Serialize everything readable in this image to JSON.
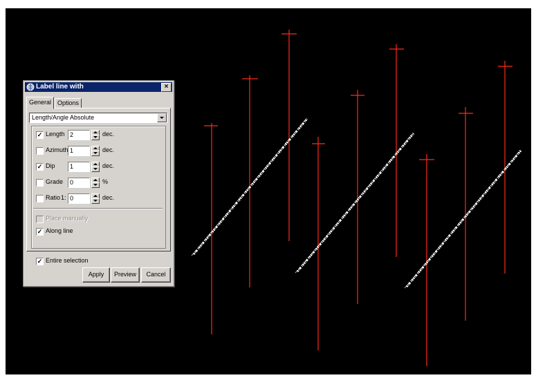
{
  "dialog": {
    "title": "Label line with",
    "close_symbol": "×",
    "tabs": [
      {
        "label": "General",
        "active": true
      },
      {
        "label": "Options",
        "active": false
      }
    ],
    "mode_select": {
      "value": "Length/Angle Absolute"
    },
    "fields": [
      {
        "id": "length",
        "label": "Length",
        "checked": true,
        "value": "2",
        "unit": "dec."
      },
      {
        "id": "azimuth",
        "label": "Azimuth",
        "checked": false,
        "value": "1",
        "unit": "dec."
      },
      {
        "id": "dip",
        "label": "Dip",
        "checked": true,
        "value": "1",
        "unit": "dec."
      },
      {
        "id": "grade",
        "label": "Grade",
        "checked": false,
        "value": "0",
        "unit": "%"
      },
      {
        "id": "ratio",
        "label": "Ratio",
        "checked": false,
        "prefix": "1:",
        "value": "0",
        "unit": "dec."
      }
    ],
    "place_manually": {
      "label": "Place manually",
      "checked": false,
      "disabled": true
    },
    "along_line": {
      "label": "Along line",
      "checked": true
    },
    "entire_selection": {
      "label": "Entire selection",
      "checked": true
    },
    "buttons": {
      "apply": "Apply",
      "preview": "Preview",
      "cancel": "Cancel"
    },
    "check_glyph": "✓"
  },
  "scene": {
    "line_color": "#ff2a1a",
    "label_color": "#ffffff",
    "background": "#000000"
  }
}
